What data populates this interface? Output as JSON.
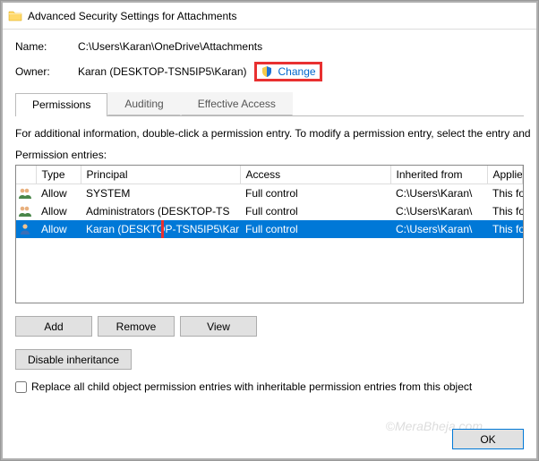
{
  "window": {
    "title": "Advanced Security Settings for Attachments"
  },
  "info": {
    "name_label": "Name:",
    "name_value": "C:\\Users\\Karan\\OneDrive\\Attachments",
    "owner_label": "Owner:",
    "owner_value": "Karan (DESKTOP-TSN5IP5\\Karan)",
    "change_label": "Change"
  },
  "tabs": {
    "permissions": "Permissions",
    "auditing": "Auditing",
    "effective": "Effective Access"
  },
  "instruction": "For additional information, double-click a permission entry. To modify a permission entry, select the entry and",
  "entries_label": "Permission entries:",
  "table": {
    "headers": {
      "type": "Type",
      "principal": "Principal",
      "access": "Access",
      "inherited": "Inherited from",
      "applies": "Applies"
    },
    "rows": [
      {
        "icon": "group",
        "type": "Allow",
        "principal": "SYSTEM",
        "access": "Full control",
        "inherited": "C:\\Users\\Karan\\",
        "applies": "This fol"
      },
      {
        "icon": "group",
        "type": "Allow",
        "principal": "Administrators (DESKTOP-TS",
        "access": "Full control",
        "inherited": "C:\\Users\\Karan\\",
        "applies": "This fol"
      },
      {
        "icon": "user",
        "type": "Allow",
        "principal": "Karan (DESKTOP-TSN5IP5\\Kar",
        "access": "Full control",
        "inherited": "C:\\Users\\Karan\\",
        "applies": "This fol"
      }
    ]
  },
  "buttons": {
    "add": "Add",
    "remove": "Remove",
    "view": "View",
    "disable": "Disable inheritance",
    "ok": "OK"
  },
  "checkbox_label": "Replace all child object permission entries with inheritable permission entries from this object",
  "watermark": "©MeraBheja.com"
}
